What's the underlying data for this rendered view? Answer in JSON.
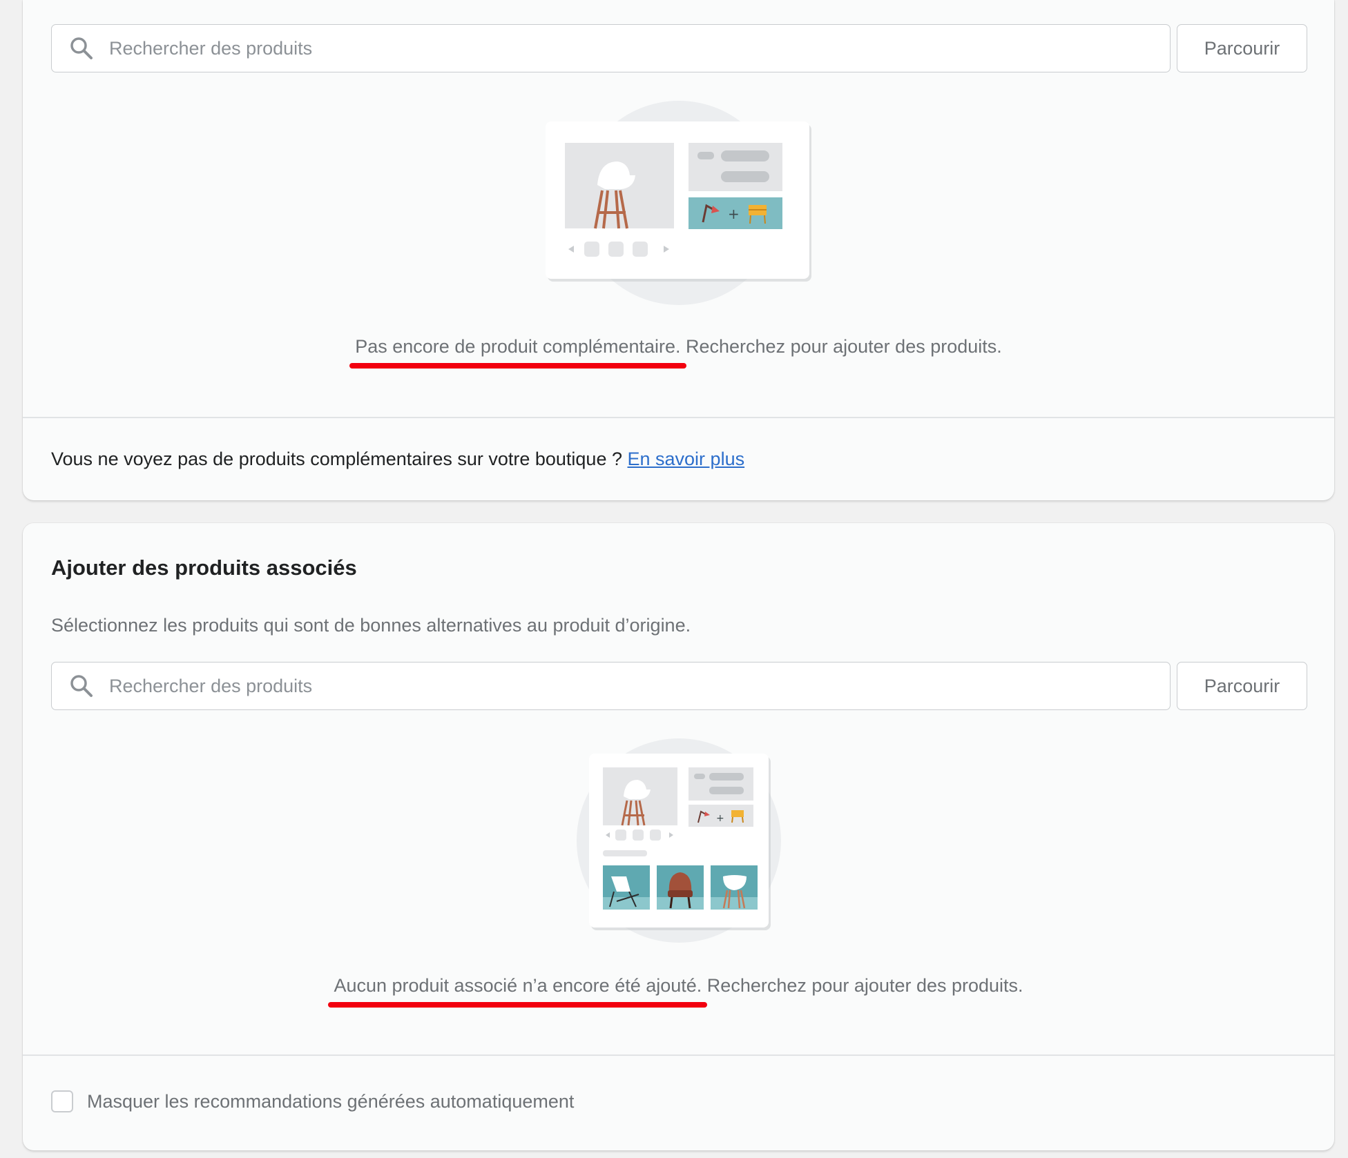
{
  "complementary": {
    "search_placeholder": "Rechercher des produits",
    "browse_label": "Parcourir",
    "empty_lead": "Pas encore de produit complémentaire.",
    "empty_rest": " Recherchez pour ajouter des produits.",
    "footer_text": "Vous ne voyez pas de produits complémentaires sur votre boutique ?",
    "footer_link": "En savoir plus"
  },
  "related": {
    "title": "Ajouter des produits associés",
    "description": "Sélectionnez les produits qui sont de bonnes alternatives au produit d’origine.",
    "search_placeholder": "Rechercher des produits",
    "browse_label": "Parcourir",
    "empty_lead": "Aucun produit associé n’a encore été ajouté.",
    "empty_rest": " Recherchez pour ajouter des produits.",
    "checkbox_label": "Masquer les recommandations générées automatiquement"
  },
  "colors": {
    "link": "#2c6ecb",
    "annotation_underline": "#f2000f",
    "illustration_teal": "#7fbcc2"
  }
}
